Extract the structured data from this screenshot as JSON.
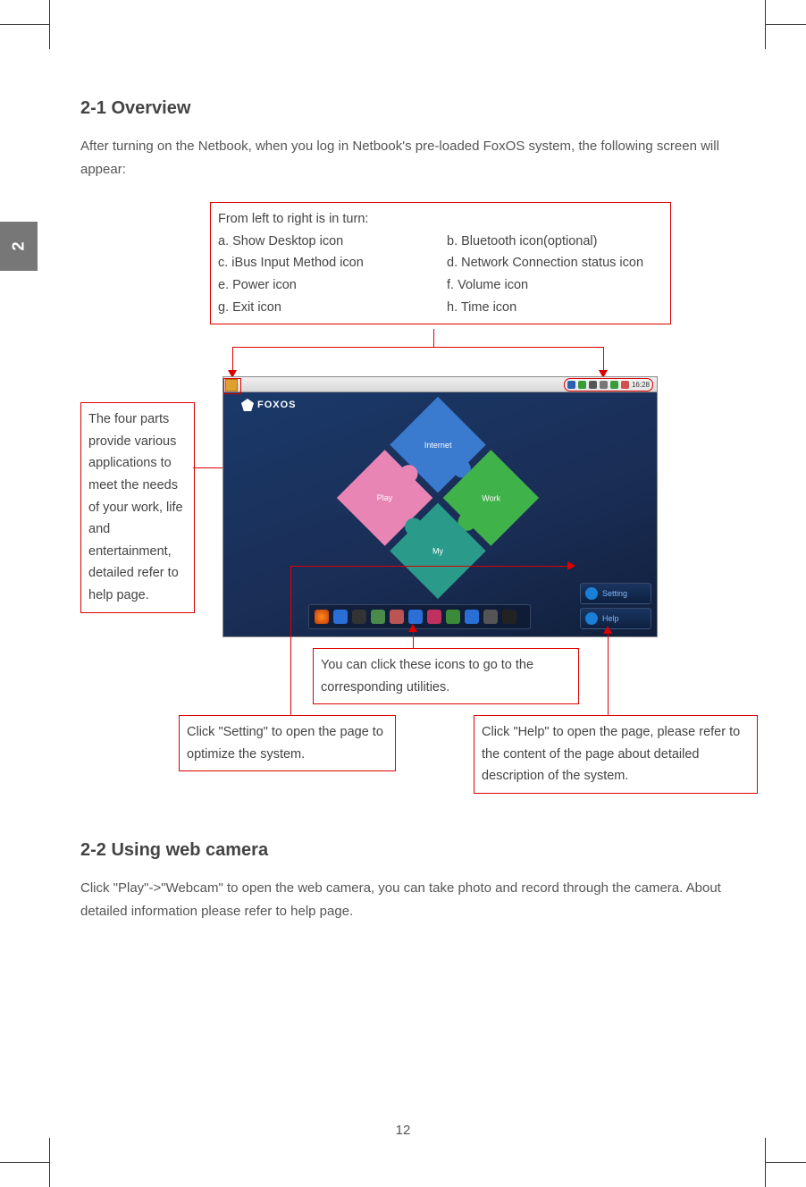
{
  "chapter_tab": "2",
  "section1": {
    "heading": "2-1 Overview",
    "intro": "After turning on the Netbook, when you log in Netbook's pre-loaded FoxOS system, the following screen will appear:"
  },
  "callout_top": {
    "intro": "From left to right is in turn:",
    "left": [
      "a. Show Desktop icon",
      "c. iBus Input Method icon",
      "e. Power icon",
      "g. Exit icon"
    ],
    "right": [
      "b. Bluetooth icon(optional)",
      "d. Network Connection status icon",
      "f. Volume icon",
      "h. Time icon"
    ]
  },
  "callout_left": "The four parts provide various applications to meet the needs of your work, life and entertainment, detailed refer to help page.",
  "callout_dock": "You can click these icons to go to the corresponding utilities.",
  "callout_setting": "Click \"Setting\" to open the page to optimize the system.",
  "callout_help": "Click \"Help\" to open the page, please refer to the content of the page about detailed description of the system.",
  "screenshot": {
    "logo": "FOXOS",
    "puzzle": {
      "top": "Internet",
      "right": "Work",
      "bottom": "My",
      "left": "Play"
    },
    "side": {
      "setting": "Setting",
      "help": "Help"
    },
    "tray_time": "16:28"
  },
  "section2": {
    "heading": "2-2 Using web camera",
    "body": "Click \"Play\"->\"Webcam\" to open the web camera, you can take photo and record through the camera. About detailed information please refer to help page."
  },
  "page_number": "12"
}
